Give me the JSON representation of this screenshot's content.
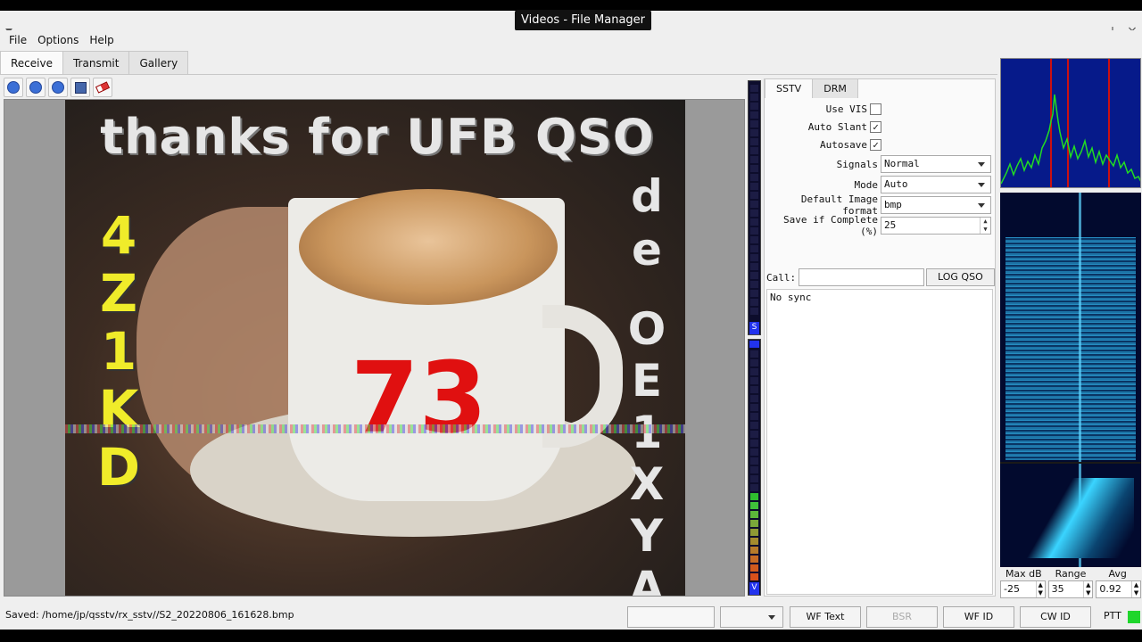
{
  "window": {
    "title": "Videos - File Manager",
    "controls": [
      "–",
      "+",
      "×"
    ]
  },
  "menu": [
    "File",
    "Options",
    "Help"
  ],
  "tabs": [
    "Receive",
    "Transmit",
    "Gallery"
  ],
  "toolbar_icons": [
    "start-icon",
    "stop-icon",
    "resync-icon",
    "save-icon",
    "erase-icon"
  ],
  "image": {
    "banner": "thanks for UFB QSO",
    "left_column": [
      "4",
      "Z",
      "1",
      "K",
      "D"
    ],
    "right_top": [
      "d",
      "e"
    ],
    "right_bottom": [
      "O",
      "E",
      "1",
      "X",
      "Y",
      "A"
    ],
    "center": "73"
  },
  "meters": {
    "upper_cap": "S",
    "lower_cap": "V"
  },
  "panel": {
    "tabs": [
      "SSTV",
      "DRM"
    ],
    "use_vis_label": "Use VIS",
    "use_vis": "",
    "auto_slant_label": "Auto Slant",
    "auto_slant": "✓",
    "autosave_label": "Autosave",
    "autosave": "✓",
    "signals_label": "Signals",
    "signals_value": "Normal",
    "mode_label": "Mode",
    "mode_value": "Auto",
    "format_label": "Default Image format",
    "format_value": "bmp",
    "save_complete_label": "Save if Complete (%)",
    "save_complete_value": "25",
    "call_label": "Call:",
    "call_value": "",
    "log_button": "LOG QSO",
    "status": "No sync"
  },
  "waterfall_controls": {
    "labels": [
      "Max dB",
      "Range",
      "Avg"
    ],
    "max_db": "-25",
    "range": "35",
    "avg": "0.92"
  },
  "statusbar": {
    "saved": "Saved: /home/jp/qsstv/rx_sstv//S2_20220806_161628.bmp",
    "wf_text": "WF Text",
    "bsr": "BSR",
    "wf_id": "WF ID",
    "cw_id": "CW ID",
    "ptt": "PTT",
    "ptt_color": "#1fd62c"
  }
}
